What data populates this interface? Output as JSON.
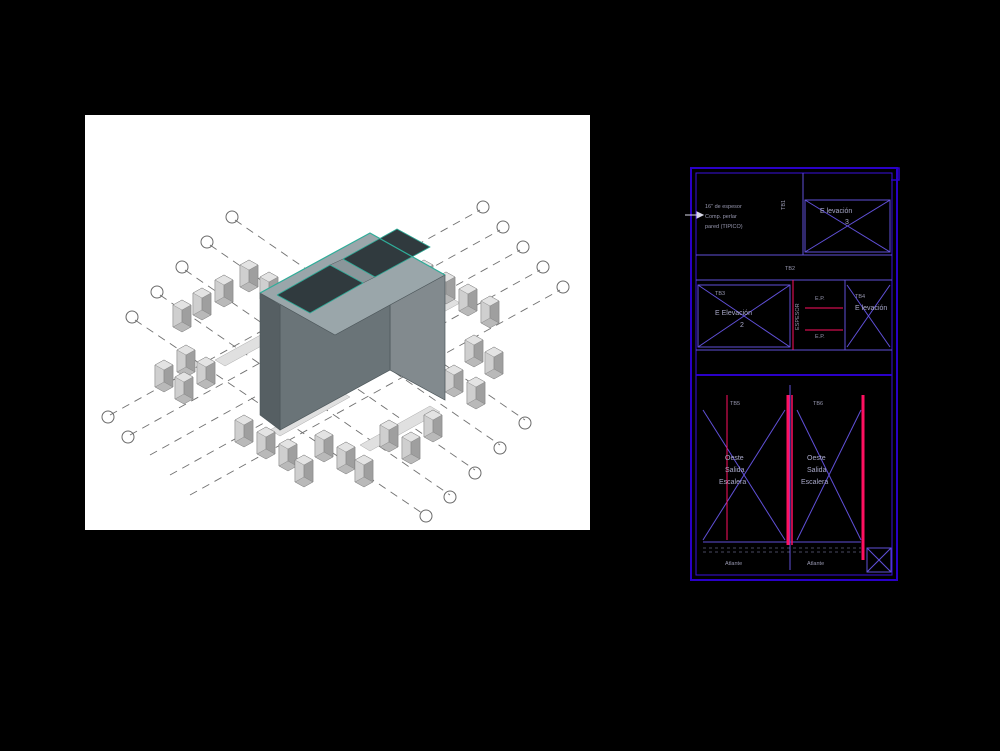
{
  "figure": {
    "left_panel": {
      "type": "3d-isometric",
      "description": "Isometric structural model: central open-top double box (elevator/stair core) on a grid of short rectangular columns with dashed grid lines and circular grid markers."
    },
    "right_panel": {
      "type": "plan-sheet",
      "frame_color": "#2a00c8",
      "accent_color": "#ff1060",
      "labels": {
        "espesor": "16\" de espesor",
        "componente": "Comp. perlar",
        "pared": "pared (TIPICO)",
        "elevacion_1": "E levación",
        "elevacion_2": "E Elevación",
        "elevacion_3": "E levación",
        "es_p": "E.P.",
        "oeste": "Oeste",
        "salida": "Salida",
        "escalera": "Escalera",
        "atlante": "Atlante",
        "refs": {
          "tb1": "TB1",
          "tb2": "TB2",
          "tb3": "TB3",
          "tb4": "TB4",
          "tb5": "TB5",
          "tb6": "TB6"
        },
        "vertical_text": "ESPESOR"
      }
    }
  }
}
